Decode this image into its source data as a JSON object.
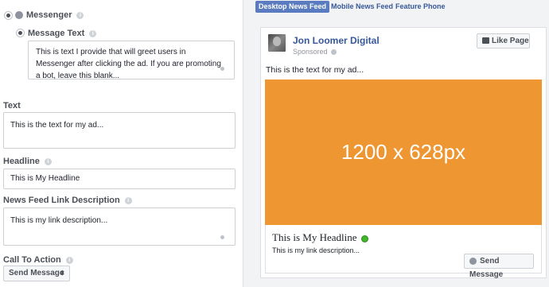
{
  "left": {
    "messenger_label": "Messenger",
    "message_text_label": "Message Text",
    "message_text_value": "This is text I provide that will greet users in Messenger after clicking the ad. If you are promoting a bot, leave this blank...",
    "text_label": "Text",
    "text_value": "This is the text for my ad...",
    "headline_label": "Headline",
    "headline_value": "This is My Headline",
    "link_desc_label": "News Feed Link Description",
    "link_desc_value": "This is my link description...",
    "cta_label": "Call To Action",
    "cta_value": "Send Message",
    "cta_arrow": "⬍"
  },
  "preview": {
    "tabs": [
      "Desktop News Feed",
      "Mobile News Feed",
      "Feature Phone"
    ],
    "page_name": "Jon Loomer Digital",
    "sponsored": "Sponsored",
    "like_page": "Like Page",
    "ad_text": "This is the text for my ad...",
    "image_label": "1200 x 628px",
    "image_color": "#ee9632",
    "headline": "This is My Headline",
    "link_description": "This is my link description...",
    "cta_button": "Send Message"
  }
}
